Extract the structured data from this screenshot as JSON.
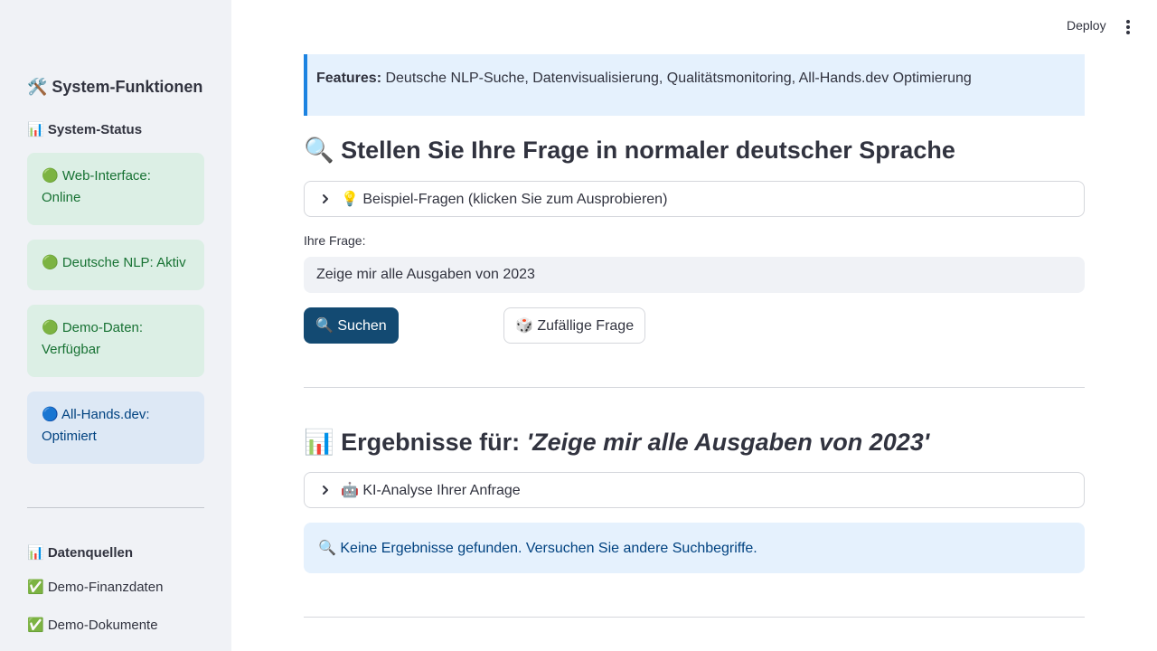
{
  "header": {
    "deploy_label": "Deploy",
    "menu_icon": "vertical-dots-icon"
  },
  "sidebar": {
    "title": "🛠️ System-Funktionen",
    "status_heading": "📊 System-Status",
    "status_items": [
      {
        "text": "🟢 Web-Interface: Online",
        "color": "#177233"
      },
      {
        "text": "🟢 Deutsche NLP: Aktiv",
        "color": "#177233"
      },
      {
        "text": "🟢 Demo-Daten: Verfügbar",
        "color": "#177233"
      },
      {
        "text": "🔵 All-Hands.dev: Optimiert",
        "color": "#004280"
      }
    ],
    "sources_heading": "📊 Datenquellen",
    "sources": [
      "✅ Demo-Finanzdaten",
      "✅ Demo-Dokumente"
    ]
  },
  "main": {
    "features_label": "Features:",
    "features_text": " Deutsche NLP-Suche, Datenvisualisierung, Qualitätsmonitoring, All-Hands.dev Optimierung",
    "question_heading": "🔍 Stellen Sie Ihre Frage in normaler deutscher Sprache",
    "examples_expander": "💡 Beispiel-Fragen (klicken Sie zum Ausprobieren)",
    "input_label": "Ihre Frage:",
    "input_value": "Zeige mir alle Ausgaben von 2023",
    "search_button": "🔍 Suchen",
    "random_button": "🎲 Zufällige Frage",
    "results_heading_prefix": "📊 Ergebnisse für: ",
    "results_heading_query": "'Zeige mir alle Ausgaben von 2023'",
    "analysis_expander": "🤖 KI-Analyse Ihrer Anfrage",
    "no_results": "🔍 Keine Ergebnisse gefunden. Versuchen Sie andere Suchbegriffe."
  },
  "colors": {
    "primary_button": "#134a72",
    "sidebar_bg": "#f0f2f6",
    "info_bg": "#e5f1fd",
    "success_text": "#177233"
  }
}
